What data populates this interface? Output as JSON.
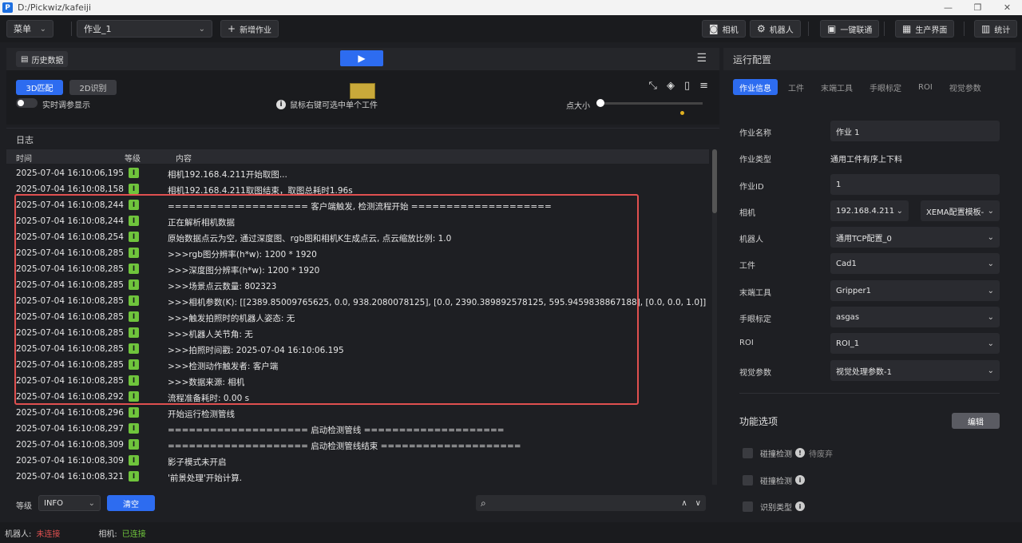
{
  "window": {
    "title": "D:/Pickwiz/kafeiji",
    "app_icon": "P",
    "controls": [
      "—",
      "❐",
      "✕"
    ]
  },
  "toolbar": {
    "menu_label": "菜单",
    "job_select": "作业_1",
    "new_job": "新增作业",
    "camera": "相机",
    "robot": "机器人",
    "one_key": "一键联通",
    "production": "生产界面",
    "stats": "统计"
  },
  "left": {
    "history_btn": "历史数据",
    "btn_3d": "3D匹配",
    "btn_2d": "2D识别",
    "toggle_label": "实时调参显示",
    "hint": "鼠标右键可选中单个工件",
    "pt_size_label": "点大小",
    "pt_size_value": 0.0
  },
  "log": {
    "title": "日志",
    "headers": {
      "time": "时间",
      "level": "等级",
      "content": "内容"
    },
    "level_badge": "I",
    "rows": [
      {
        "time": "2025-07-04 16:10:06,195",
        "content": "相机192.168.4.211开始取图..."
      },
      {
        "time": "2025-07-04 16:10:08,158",
        "content": "相机192.168.4.211取图结束，取图总耗时1.96s"
      },
      {
        "time": "2025-07-04 16:10:08,244",
        "content": "==================== 客户端触发, 检测流程开始 ===================="
      },
      {
        "time": "2025-07-04 16:10:08,244",
        "content": "正在解析相机数据"
      },
      {
        "time": "2025-07-04 16:10:08,254",
        "content": "原始数据点云为空, 通过深度图、rgb图和相机K生成点云, 点云缩放比例: 1.0"
      },
      {
        "time": "2025-07-04 16:10:08,285",
        "content": ">>>rgb图分辨率(h*w): 1200 * 1920"
      },
      {
        "time": "2025-07-04 16:10:08,285",
        "content": ">>>深度图分辨率(h*w): 1200 * 1920"
      },
      {
        "time": "2025-07-04 16:10:08,285",
        "content": ">>>场景点云数量: 802323"
      },
      {
        "time": "2025-07-04 16:10:08,285",
        "content": ">>>相机参数(K): [[2389.85009765625, 0.0, 938.2080078125], [0.0, 2390.389892578125, 595.9459838867188], [0.0, 0.0, 1.0]]"
      },
      {
        "time": "2025-07-04 16:10:08,285",
        "content": ">>>触发拍照时的机器人姿态: 无"
      },
      {
        "time": "2025-07-04 16:10:08,285",
        "content": ">>>机器人关节角: 无"
      },
      {
        "time": "2025-07-04 16:10:08,285",
        "content": ">>>拍照时间戳: 2025-07-04 16:10:06.195"
      },
      {
        "time": "2025-07-04 16:10:08,285",
        "content": ">>>检测动作触发者: 客户端"
      },
      {
        "time": "2025-07-04 16:10:08,285",
        "content": ">>>数据来源: 相机"
      },
      {
        "time": "2025-07-04 16:10:08,292",
        "content": "流程准备耗时: 0.00 s"
      },
      {
        "time": "2025-07-04 16:10:08,296",
        "content": "开始运行检测管线"
      },
      {
        "time": "2025-07-04 16:10:08,297",
        "content": "==================== 启动检测管线 ===================="
      },
      {
        "time": "2025-07-04 16:10:08,309",
        "content": "==================== 启动检测管线结束 ===================="
      },
      {
        "time": "2025-07-04 16:10:08,309",
        "content": "影子模式未开启"
      },
      {
        "time": "2025-07-04 16:10:08,321",
        "content": "'前景处理'开始计算."
      }
    ],
    "level_label": "等级",
    "level_value": "INFO",
    "clear_btn": "清空",
    "search_placeholder": ""
  },
  "right": {
    "title": "运行配置",
    "tabs": [
      "作业信息",
      "工件",
      "末端工具",
      "手眼标定",
      "ROI",
      "视觉参数"
    ],
    "fields": {
      "job_name": {
        "label": "作业名称",
        "value": "作业 1"
      },
      "job_type": {
        "label": "作业类型",
        "value": "通用工件有序上下料"
      },
      "job_id": {
        "label": "作业ID",
        "value": "1"
      },
      "camera": {
        "label": "相机",
        "value": "192.168.4.211",
        "value2": "XEMA配置模板-"
      },
      "robot": {
        "label": "机器人",
        "value": "通用TCP配置_0"
      },
      "workpiece": {
        "label": "工件",
        "value": "Cad1"
      },
      "tool": {
        "label": "末端工具",
        "value": "Gripper1"
      },
      "calib": {
        "label": "手眼标定",
        "value": "asgas"
      },
      "roi": {
        "label": "ROI",
        "value": "ROI_1"
      },
      "vision": {
        "label": "视觉参数",
        "value": "视觉处理参数-1"
      }
    },
    "func_title": "功能选项",
    "edit_btn": "编辑",
    "options": [
      {
        "label": "碰撞检测",
        "note": "待废弃"
      },
      {
        "label": "碰撞检测",
        "note": ""
      },
      {
        "label": "识别类型",
        "note": ""
      }
    ]
  },
  "status": {
    "robot_label": "机器人:",
    "robot_value": "未连接",
    "camera_label": "相机:",
    "camera_value": "已连接"
  }
}
